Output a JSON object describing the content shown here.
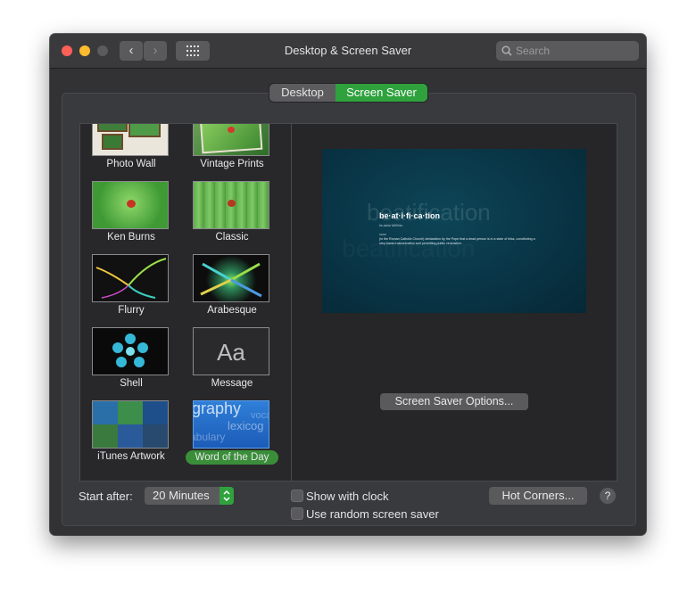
{
  "window": {
    "title": "Desktop & Screen Saver"
  },
  "search": {
    "placeholder": "Search"
  },
  "tabs": [
    {
      "label": "Desktop",
      "selected": false
    },
    {
      "label": "Screen Saver",
      "selected": true
    }
  ],
  "savers": [
    {
      "label": "Photo Wall"
    },
    {
      "label": "Vintage Prints"
    },
    {
      "label": "Ken Burns"
    },
    {
      "label": "Classic"
    },
    {
      "label": "Flurry"
    },
    {
      "label": "Arabesque"
    },
    {
      "label": "Shell"
    },
    {
      "label": "Message",
      "thumb_text": "Aa"
    },
    {
      "label": "iTunes Artwork"
    },
    {
      "label": "Word of the Day",
      "selected": true,
      "thumb_words": [
        "graphy",
        "vocab",
        "lexicog",
        "abulary"
      ]
    }
  ],
  "preview": {
    "word": "be·at·i·fi·ca·tion",
    "background_word": "beatification",
    "pronunciation": "be,atəfəˈkāSHən",
    "part_of_speech": "noun",
    "definition": "(in the Roman Catholic Church) declaration by the Pope that a dead person is in a state of bliss, constituting a step toward canonization and permitting public veneration."
  },
  "options_button": "Screen Saver Options...",
  "start_after": {
    "label": "Start after:",
    "value": "20 Minutes"
  },
  "show_with_clock": {
    "label": "Show with clock",
    "checked": false
  },
  "random_saver": {
    "label": "Use random screen saver",
    "checked": false
  },
  "hot_corners_button": "Hot Corners...",
  "help_button": "?",
  "colors": {
    "accent": "#2fa23e",
    "window_bg": "#323235",
    "selected_label": "#3a8e3a"
  }
}
